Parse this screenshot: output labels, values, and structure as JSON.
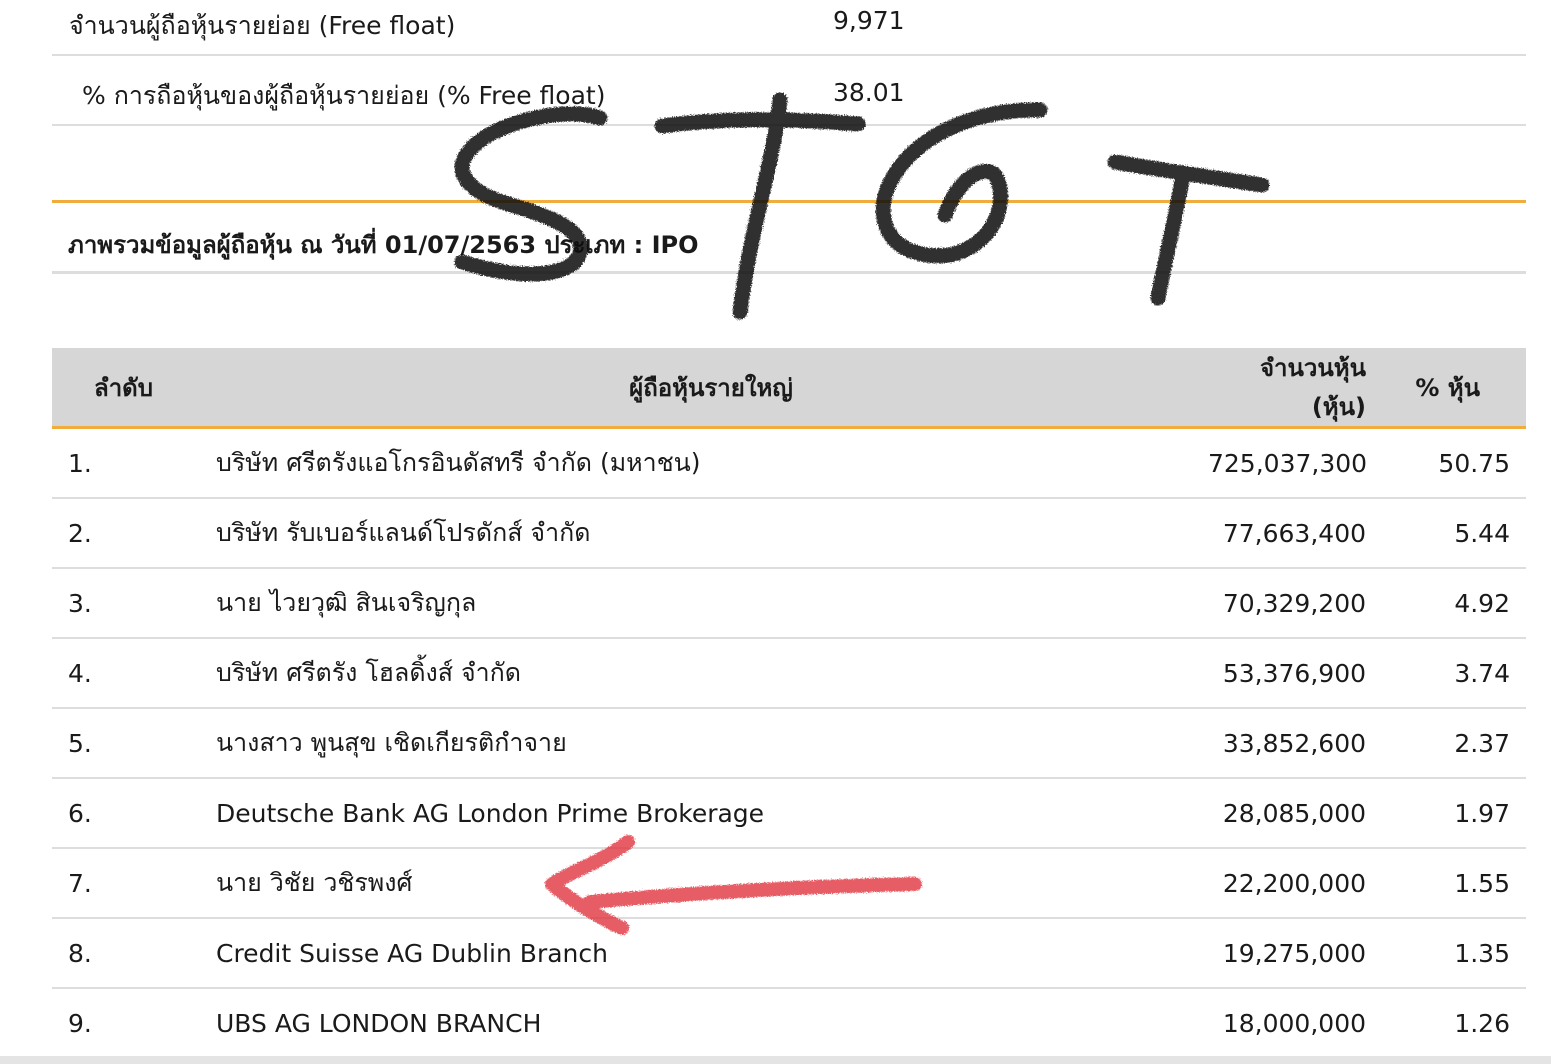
{
  "free_float": {
    "holders_label": "จำนวนผู้ถือหุ้นรายย่อย (Free float)",
    "holders_value": "9,971",
    "percent_label": "% การถือหุ้นของผู้ถือหุ้นรายย่อย (% Free float)",
    "percent_value": "38.01"
  },
  "section_title": "ภาพรวมข้อมูลผู้ถือหุ้น ณ วันที่ 01/07/2563 ประเภท : IPO",
  "table": {
    "headers": {
      "rank": "ลำดับ",
      "name": "ผู้ถือหุ้นรายใหญ่",
      "shares": "จำนวนหุ้น (หุ้น)",
      "pct": "% หุ้น"
    },
    "rows": [
      {
        "rank": "1.",
        "name": "บริษัท ศรีตรังแอโกรอินดัสทรี จำกัด (มหาชน)",
        "shares": "725,037,300",
        "pct": "50.75"
      },
      {
        "rank": "2.",
        "name": "บริษัท รับเบอร์แลนด์โปรดักส์ จำกัด",
        "shares": "77,663,400",
        "pct": "5.44"
      },
      {
        "rank": "3.",
        "name": "นาย ไวยวุฒิ สินเจริญกุล",
        "shares": "70,329,200",
        "pct": "4.92"
      },
      {
        "rank": "4.",
        "name": "บริษัท ศรีตรัง โฮลดิ้งส์ จำกัด",
        "shares": "53,376,900",
        "pct": "3.74"
      },
      {
        "rank": "5.",
        "name": "นางสาว พูนสุข เชิดเกียรติกำจาย",
        "shares": "33,852,600",
        "pct": "2.37"
      },
      {
        "rank": "6.",
        "name": "Deutsche Bank AG London Prime Brokerage",
        "shares": "28,085,000",
        "pct": "1.97"
      },
      {
        "rank": "7.",
        "name": "นาย วิชัย วชิรพงศ์",
        "shares": "22,200,000",
        "pct": "1.55"
      },
      {
        "rank": "8.",
        "name": "Credit Suisse AG Dublin Branch",
        "shares": "19,275,000",
        "pct": "1.35"
      },
      {
        "rank": "9.",
        "name": "UBS AG LONDON BRANCH",
        "shares": "18,000,000",
        "pct": "1.26"
      }
    ]
  },
  "annotations": {
    "handwritten_text": "STGT",
    "ink_color": "#111111",
    "arrow_color": "#e0343f",
    "arrow_points_to_row": "7."
  },
  "colors": {
    "accent": "#f0ad3c",
    "header_bg": "#d6d6d6",
    "divider": "#dddddd"
  }
}
